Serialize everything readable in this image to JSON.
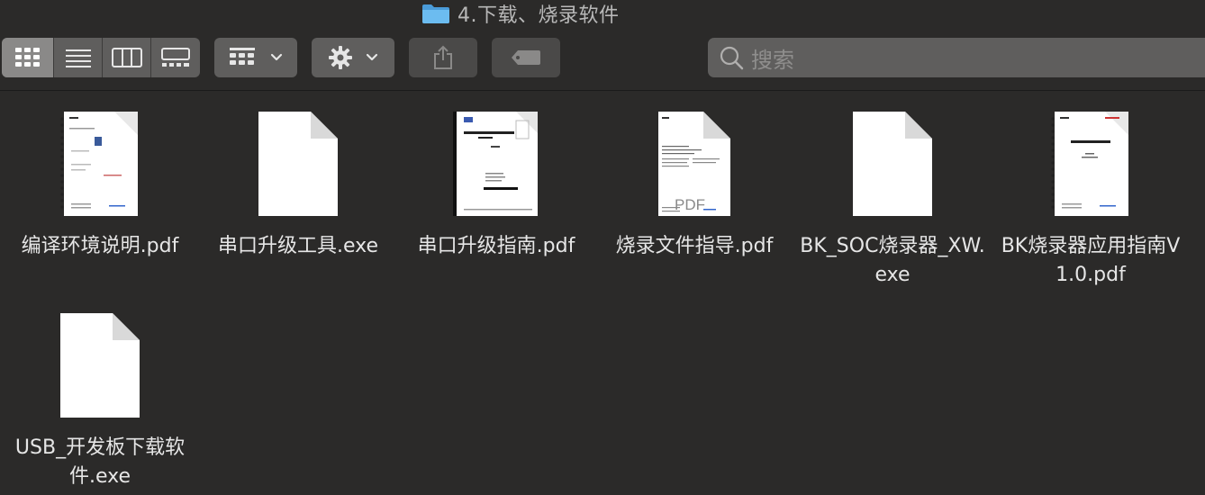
{
  "window": {
    "title": "4.下载、烧录软件"
  },
  "toolbar": {
    "view_modes": [
      "icon-view",
      "list-view",
      "column-view",
      "gallery-view"
    ],
    "active_view": "icon-view",
    "group_button_icon": "group-grid-icon",
    "action_button_icon": "gear-icon",
    "share_button_icon": "share-icon",
    "tag_button_icon": "tag-icon",
    "search_placeholder": "搜索"
  },
  "files": [
    {
      "name": "编译环境说明.pdf",
      "kind": "pdf"
    },
    {
      "name": "串口升级工具.exe",
      "kind": "exe"
    },
    {
      "name": "串口升级指南.pdf",
      "kind": "pdf"
    },
    {
      "name": "烧录文件指导.pdf",
      "kind": "pdf",
      "overlay": "PDF"
    },
    {
      "name": "BK_SOC烧录器_XW.exe",
      "kind": "exe"
    },
    {
      "name": "BK烧录器应用指南V1.0.pdf",
      "kind": "pdf"
    },
    {
      "name": "USB_开发板下载软件.exe",
      "kind": "exe"
    }
  ],
  "colors": {
    "background": "#2b2a29",
    "toolbar_button": "#5f5e5d",
    "folder_blue": "#5ab0ea",
    "text": "#e6e6e6"
  }
}
